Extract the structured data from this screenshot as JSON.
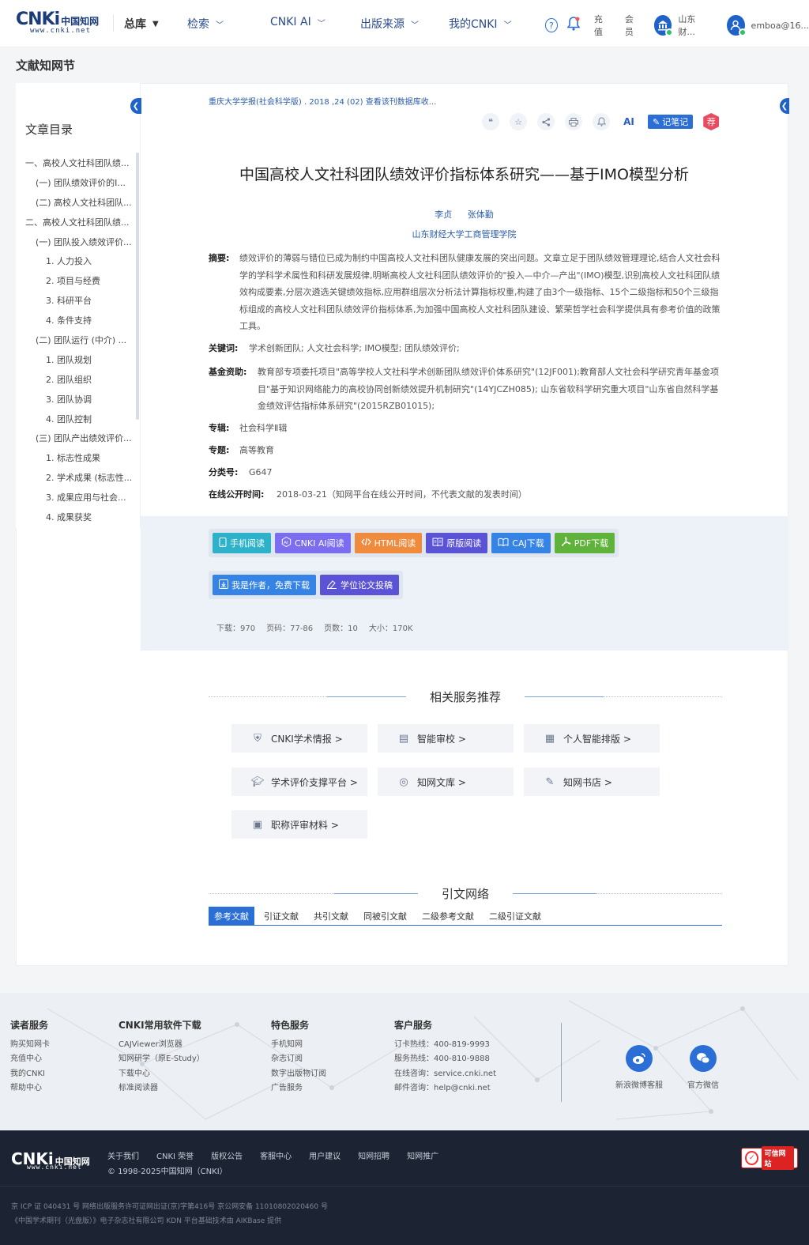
{
  "header": {
    "logo_text": "CNKi",
    "logo_cn": "中国知网",
    "logo_url": "www.cnki.net",
    "nav": [
      {
        "label": "总库"
      },
      {
        "label": "检索"
      },
      {
        "label": "CNKI AI"
      },
      {
        "label": "出版来源"
      },
      {
        "label": "我的CNKI"
      }
    ],
    "recharge": "充值",
    "member": "会员",
    "institution": "山东财...",
    "user": "emboa@16..."
  },
  "page_title": "文献知网节",
  "toc": {
    "title": "文章目录",
    "items": [
      {
        "label": "一、高校人文社科团队绩...",
        "level": 1
      },
      {
        "label": "(一) 团队绩效评价的I...",
        "level": 2
      },
      {
        "label": "(二) 高校人文社科团队...",
        "level": 2
      },
      {
        "label": "二、高校人文社科团队绩...",
        "level": 1
      },
      {
        "label": "(一) 团队投入绩效评价...",
        "level": 2
      },
      {
        "label": "1. 人力投入",
        "level": 3
      },
      {
        "label": "2. 项目与经费",
        "level": 3
      },
      {
        "label": "3. 科研平台",
        "level": 3
      },
      {
        "label": "4. 条件支持",
        "level": 3
      },
      {
        "label": "(二) 团队运行 (中介) ...",
        "level": 2
      },
      {
        "label": "1. 团队规划",
        "level": 3
      },
      {
        "label": "2. 团队组织",
        "level": 3
      },
      {
        "label": "3. 团队协调",
        "level": 3
      },
      {
        "label": "4. 团队控制",
        "level": 3
      },
      {
        "label": "(三) 团队产出绩效评价...",
        "level": 2
      },
      {
        "label": "1. 标志性成果",
        "level": 3
      },
      {
        "label": "2. 学术成果 (标志性...",
        "level": 3
      },
      {
        "label": "3. 成果应用与社会...",
        "level": 3
      },
      {
        "label": "4. 成果获奖",
        "level": 3
      }
    ]
  },
  "article": {
    "journal_line": "重庆大学学报(社会科学版) .  2018 ,24 (02)   查看该刊数据库收...",
    "toolbar": {
      "note_label": "记笔记",
      "ai_label": "AI",
      "rec_label": "荐"
    },
    "title": "中国高校人文社科团队绩效评价指标体系研究——基于IMO模型分析",
    "authors": [
      "李贞",
      "张体勤"
    ],
    "affiliation": "山东财经大学工商管理学院",
    "abstract_label": "摘要:",
    "abstract": "绩效评价的薄弱与错位已成为制约中国高校人文社科团队健康发展的突出问题。文章立足于团队绩效管理理论,结合人文社会科学的学科学术属性和科研发展规律,明晰高校人文社科团队绩效评价的\"投入—中介—产出\"(IMO)模型,识别高校人文社科团队绩效构成要素,分层次遴选关键绩效指标,应用群组层次分析法计算指标权重,构建了由3个一级指标、15个二级指标和50个三级指标组成的高校人文社科团队绩效评价指标体系,为加强中国高校人文社科团队建设、繁荣哲学社会科学提供具有参考价值的政策工具。",
    "keywords_label": "关键词:",
    "keywords": "学术创新团队;  人文社会科学;  IMO模型;  团队绩效评价;",
    "fund_label": "基金资助:",
    "fund": "教育部专项委托项目\"高等学校人文社科学术创新团队绩效评价体系研究\"(12JF001);教育部人文社会科学研究青年基金项目\"基于知识网络能力的高校协同创新绩效提升机制研究\"(14YJCZH085);  山东省软科学研究重大项目\"山东省自然科学基金绩效评估指标体系研究\"(2015RZB01015);",
    "series_label": "专辑:",
    "series": "社会科学Ⅱ辑",
    "topic_label": "专题:",
    "topic": "高等教育",
    "class_label": "分类号:",
    "class": "G647",
    "online_label": "在线公开时间:",
    "online": "2018-03-21（知网平台在线公开时间，不代表文献的发表时间）"
  },
  "downloads": {
    "buttons_row1": [
      {
        "label": "手机阅读",
        "color": "#2db2c9",
        "icon": "phone-icon"
      },
      {
        "label": "CNKI AI阅读",
        "color": "#7b6cf0",
        "icon": "ai-icon"
      },
      {
        "label": "HTML阅读",
        "color": "#f08a3c",
        "icon": "code-icon"
      },
      {
        "label": "原版阅读",
        "color": "#5b53d6",
        "icon": "book-icon"
      },
      {
        "label": "CAJ下载",
        "color": "#3583e5",
        "icon": "book-open-icon"
      },
      {
        "label": "PDF下载",
        "color": "#5fb33b",
        "icon": "pdf-icon"
      }
    ],
    "buttons_row2": [
      {
        "label": "我是作者，免费下载",
        "color": "#3583e5",
        "icon": "download-icon"
      },
      {
        "label": "学位论文投稿",
        "color": "#5b53d6",
        "icon": "pen-icon"
      }
    ],
    "stats": {
      "downloads": "下载：970",
      "pages_range": "页码：77-86",
      "page_count": "页数：10",
      "size": "大小：170K"
    }
  },
  "related": {
    "title": "相关服务推荐",
    "items": [
      {
        "label": "CNKI学术情报 >",
        "icon": "intel-icon"
      },
      {
        "label": "智能审校 >",
        "icon": "review-icon"
      },
      {
        "label": "个人智能排版 >",
        "icon": "layout-icon"
      },
      {
        "label": "学术评价支撑平台 >",
        "icon": "graduation-cap-icon"
      },
      {
        "label": "知网文库 >",
        "icon": "library-icon"
      },
      {
        "label": "知网书店 >",
        "icon": "bookstore-icon"
      },
      {
        "label": "职称评审材料 >",
        "icon": "certificate-icon"
      }
    ]
  },
  "citations": {
    "title": "引文网络",
    "tabs": [
      "参考文献",
      "引证文献",
      "共引文献",
      "同被引文献",
      "二级参考文献",
      "二级引证文献"
    ]
  },
  "footer": {
    "cols": [
      {
        "title": "读者服务",
        "items": [
          "购买知网卡",
          "充值中心",
          "我的CNKI",
          "帮助中心"
        ]
      },
      {
        "title": "CNKI常用软件下载",
        "items": [
          "CAJViewer浏览器",
          "知网研学（原E-Study）",
          "下载中心",
          "标准阅读器"
        ]
      },
      {
        "title": "特色服务",
        "items": [
          "手机知网",
          "杂志订阅",
          "数字出版物订阅",
          "广告服务"
        ]
      },
      {
        "title": "客户服务",
        "items": [
          "订卡热线：400-819-9993",
          "服务热线：400-810-9888",
          "在线咨询：service.cnki.net",
          "邮件咨询：help@cnki.net"
        ]
      }
    ],
    "social": [
      {
        "label": "新浪微博客服",
        "icon": "weibo-icon"
      },
      {
        "label": "官方微信",
        "icon": "wechat-icon"
      }
    ],
    "links": [
      "关于我们",
      "CNKI 荣誉",
      "版权公告",
      "客服中心",
      "用户建议",
      "知网招聘",
      "知网推广"
    ],
    "copyright": "© 1998-2025中国知网（CNKI）",
    "icp1": "京 ICP 证 040431 号  网络出版服务许可证网出证(京)字第416号  京公网安备 11010802020460 号",
    "icp2": "《中国学术期刊（光盘版）》电子杂志社有限公司  KDN 平台基础技术由 AIKBase 提供",
    "trust_label": "可信网站"
  }
}
